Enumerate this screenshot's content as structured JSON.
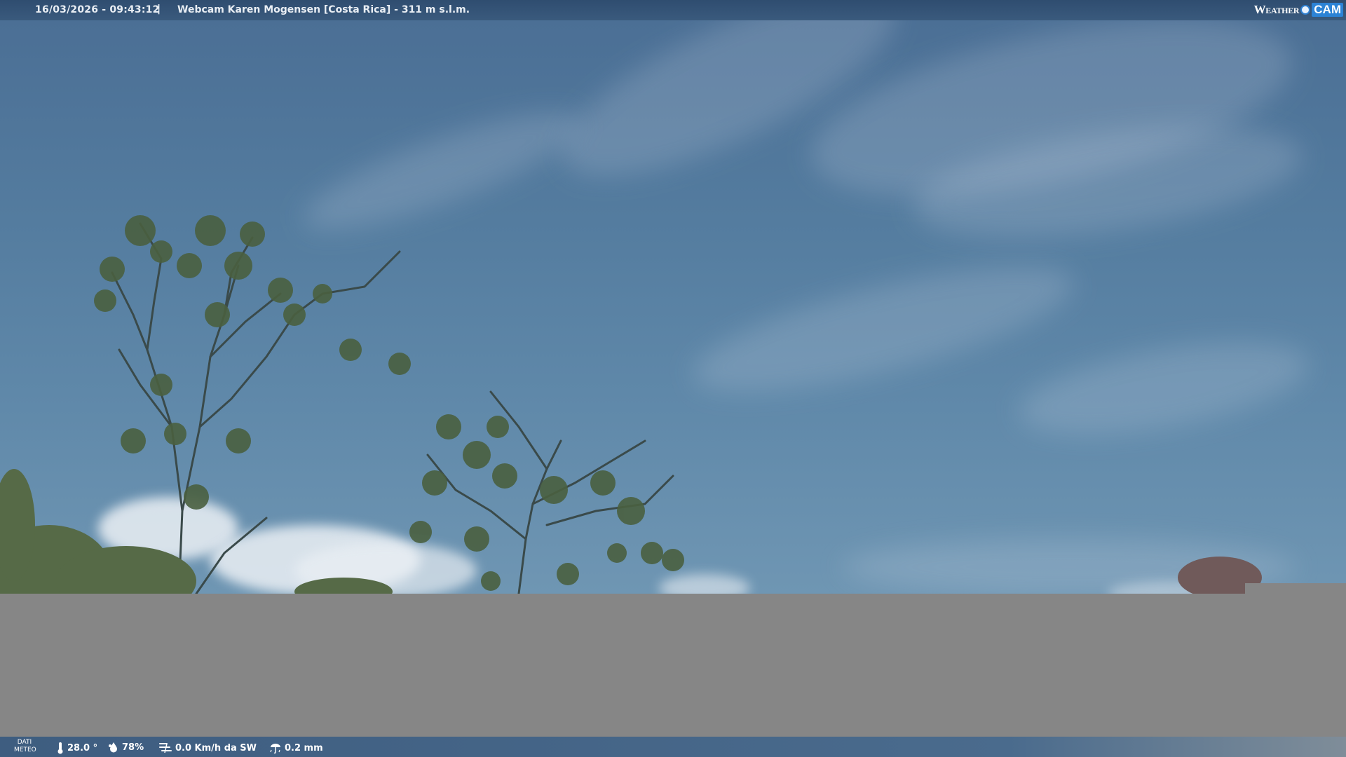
{
  "topbar": {
    "datetime": "16/03/2026 - 09:43:12",
    "separator": "|",
    "title": "Webcam Karen Mogensen [Costa Rica]  - 311 m s.l.m."
  },
  "logo": {
    "weather": "Weather",
    "cam": "CAM"
  },
  "bottombar": {
    "dati_line1": "DATI",
    "dati_line2": "METEO",
    "temperature": "28.0 °",
    "humidity": "78%",
    "wind": "0.0 Km/h da SW",
    "rain": "0.2 mm"
  },
  "icons": {
    "temperature": "thermometer-icon",
    "humidity": "humidity-icon",
    "wind": "wind-icon",
    "rain": "rain-icon"
  }
}
